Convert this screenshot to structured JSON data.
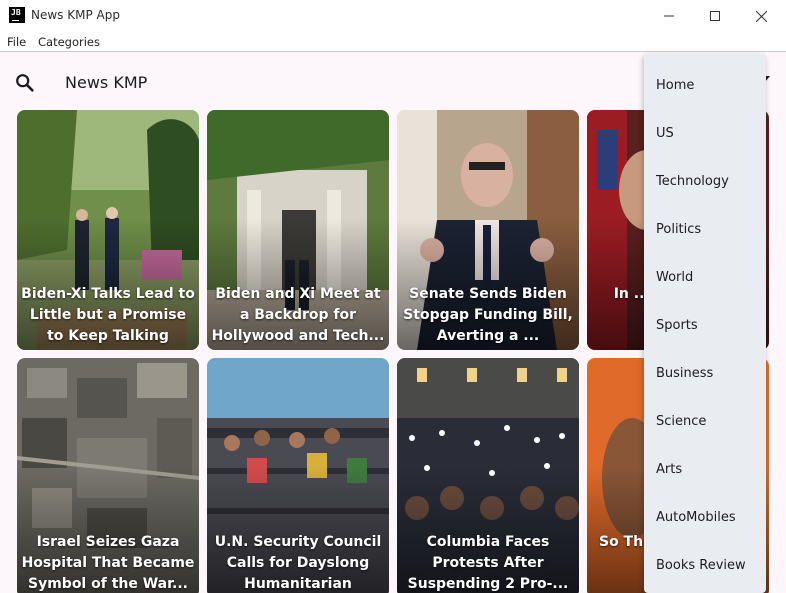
{
  "window": {
    "title": "News KMP App",
    "logo_text": "JB"
  },
  "menubar": {
    "items": [
      "File",
      "Categories"
    ]
  },
  "app": {
    "title": "News KMP"
  },
  "articles": [
    {
      "headline": "Biden-Xi Talks Lead to Little but a Promise to Keep Talking"
    },
    {
      "headline": "Biden and Xi Meet at a Backdrop for Hollywood and Tech..."
    },
    {
      "headline": "Senate Sends Biden Stopgap Funding Bill, Averting a ..."
    },
    {
      "headline": "In ... She... Un..."
    },
    {
      "headline": "Israel Seizes Gaza Hospital That Became Symbol of the War..."
    },
    {
      "headline": "U.N. Security Council Calls for Dayslong Humanitarian Pauses..."
    },
    {
      "headline": "Columbia Faces Protests After Suspending 2 Pro-..."
    },
    {
      "headline": "So Th... Yo... Conv..."
    }
  ],
  "categories_menu": {
    "items": [
      "Home",
      "US",
      "Technology",
      "Politics",
      "World",
      "Sports",
      "Business",
      "Science",
      "Arts",
      "AutoMobiles",
      "Books Review"
    ]
  },
  "colors": {
    "app_background": "#fdf7fc",
    "menu_background": "#e9edf1",
    "headline_text": "#ffffff"
  }
}
